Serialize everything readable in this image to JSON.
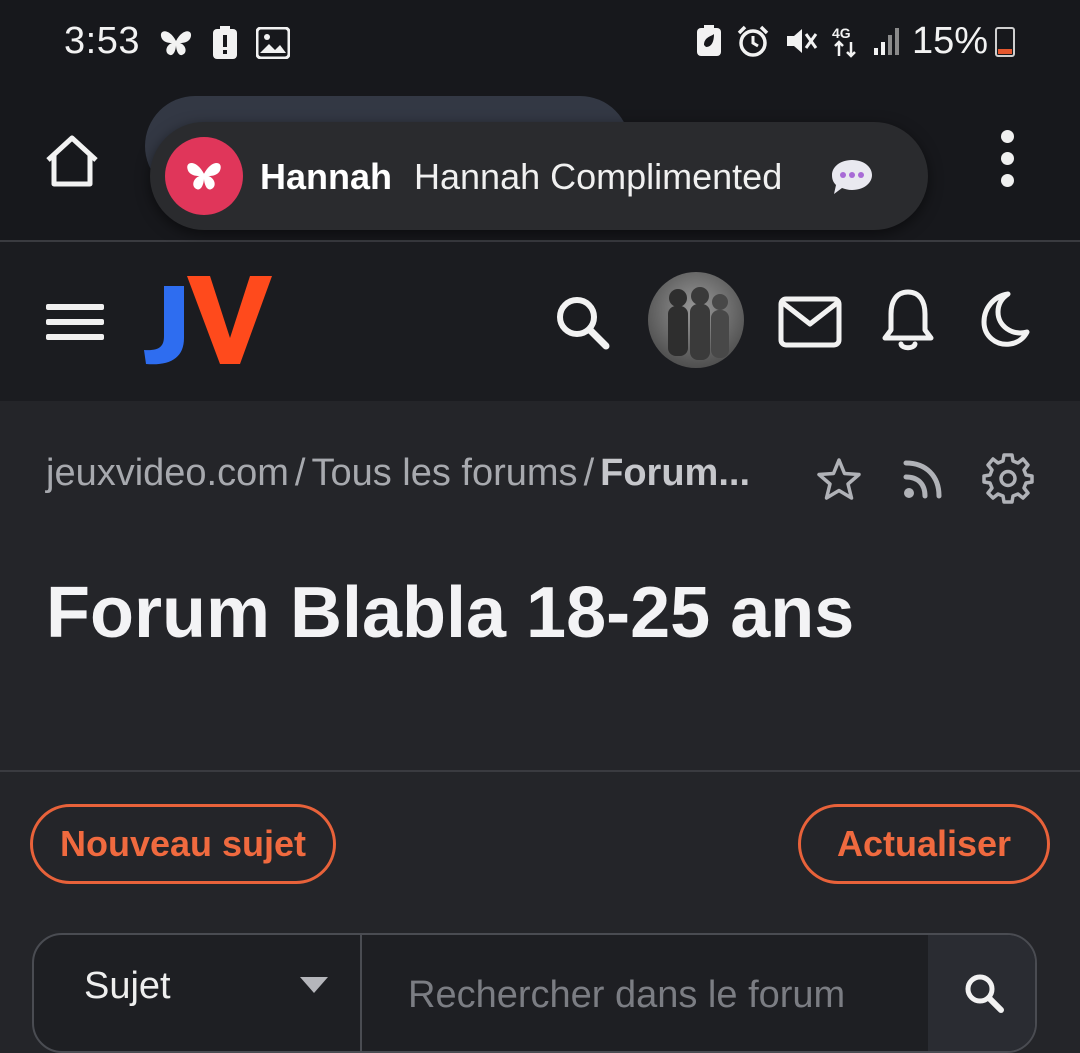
{
  "status_bar": {
    "time": "3:53",
    "battery_percent": "15%",
    "left_icons": [
      "butterfly-icon",
      "battery-alert-icon",
      "image-icon"
    ],
    "right_icons": [
      "battery-saver-icon",
      "alarm-icon",
      "mute-icon",
      "4g-icon",
      "signal-icon",
      "battery-icon"
    ],
    "battery_level": 0.15
  },
  "browser": {
    "home_icon": "home-icon",
    "menu_icon": "more-vert-icon"
  },
  "notification": {
    "sender": "Hannah",
    "message": "Hannah Complimented",
    "app_icon": "butterfly-icon",
    "emoji_icon": "speech-bubble-icon",
    "accent": "#e0365a"
  },
  "site_header": {
    "logo_text": "JV",
    "icons": [
      "menu-icon",
      "search-icon",
      "avatar",
      "mail-icon",
      "bell-icon",
      "moon-icon"
    ]
  },
  "breadcrumb": {
    "items": [
      "jeuxvideo.com",
      "Tous les forums",
      "Forum..."
    ],
    "separator": "/"
  },
  "page": {
    "title": "Forum Blabla 18-25 ans"
  },
  "actions": {
    "new_topic": "Nouveau sujet",
    "refresh": "Actualiser",
    "accent": "#e8623a"
  },
  "search": {
    "select_value": "Sujet",
    "placeholder": "Rechercher dans le forum"
  }
}
